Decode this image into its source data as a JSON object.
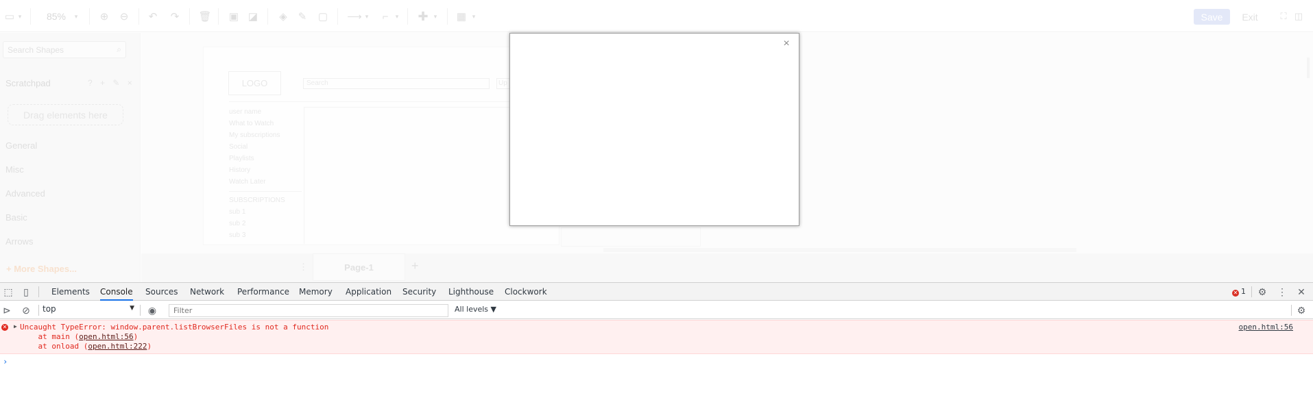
{
  "toolbar": {
    "zoom": "85%",
    "save_label": "Save",
    "exit_label": "Exit"
  },
  "sidebar": {
    "search_placeholder": "Search Shapes",
    "scratchpad": "Scratchpad",
    "scratch_tools": "? + ✎ ×",
    "drag_hint": "Drag elements here",
    "categories": [
      "General",
      "Misc",
      "Advanced",
      "Basic",
      "Arrows"
    ],
    "more_shapes": "+ More Shapes..."
  },
  "canvas": {
    "logo": "LOGO",
    "search": "Search",
    "up": "Up",
    "nav": [
      "user name",
      "What to Watch",
      "My subscriptions",
      "Social",
      "Playlists",
      "History",
      "Watch Later",
      "SUBSCRIPTIONS",
      "sub 1",
      "sub 2",
      "sub 3"
    ]
  },
  "pages": {
    "tab": "Page-1",
    "add": "+"
  },
  "dialog": {
    "close": "×"
  },
  "devtools": {
    "tabs": [
      "Elements",
      "Console",
      "Sources",
      "Network",
      "Performance",
      "Memory",
      "Application",
      "Security",
      "Lighthouse",
      "Clockwork"
    ],
    "active_tab": "Console",
    "error_count": "1",
    "context": "top",
    "filter_placeholder": "Filter",
    "levels": "All levels ▼",
    "error": {
      "message": "Uncaught TypeError: window.parent.listBrowserFiles is not a function",
      "line1_prefix": "    at main (",
      "line1_link": "open.html:56",
      "line1_suffix": ")",
      "line2_prefix": "    at onload (",
      "line2_link": "open.html:222",
      "line2_suffix": ")",
      "source": "open.html:56"
    },
    "prompt": "›"
  }
}
